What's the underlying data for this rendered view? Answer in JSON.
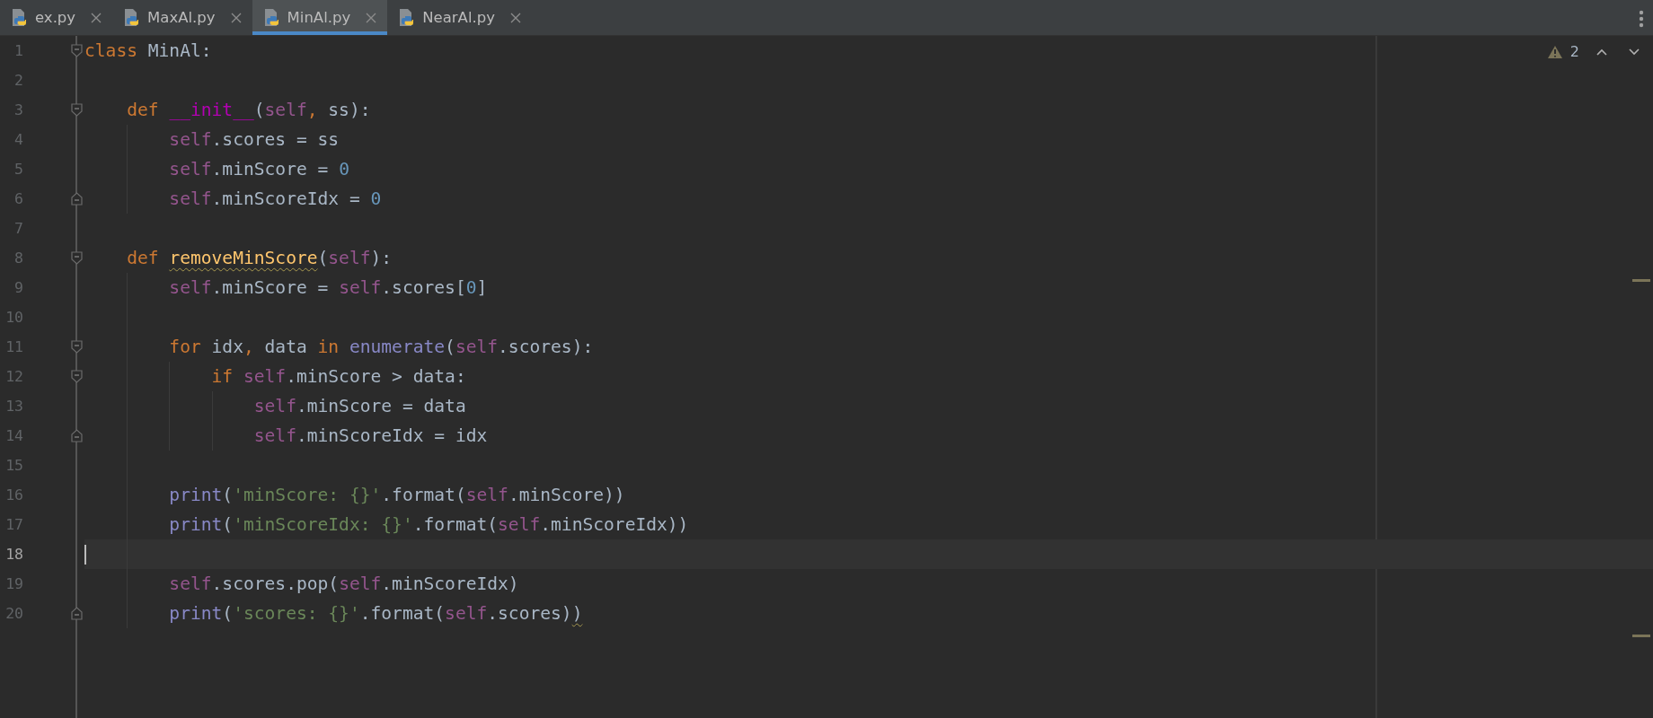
{
  "tabs": [
    {
      "label": "ex.py",
      "selected": false
    },
    {
      "label": "MaxAl.py",
      "selected": false
    },
    {
      "label": "MinAl.py",
      "selected": true
    },
    {
      "label": "NearAl.py",
      "selected": false
    }
  ],
  "inspections": {
    "warning_count": "2"
  },
  "lines": [
    {
      "number": "1",
      "current": false,
      "fold_start": true,
      "tokens": [
        {
          "text": "class",
          "kind": "keyword"
        },
        {
          "text": " MinAl:",
          "kind": "plain"
        }
      ]
    },
    {
      "number": "2",
      "current": false
    },
    {
      "number": "3",
      "current": false,
      "fold_start": true,
      "tokens": [
        {
          "text": "    def ",
          "kind": "keyword"
        },
        {
          "text": "__init__",
          "kind": "magic"
        },
        {
          "text": "(",
          "kind": "plain"
        },
        {
          "text": "self",
          "kind": "self"
        },
        {
          "text": ",",
          "kind": "keyword"
        },
        {
          "text": " ss):",
          "kind": "plain"
        }
      ]
    },
    {
      "number": "4",
      "current": false,
      "tokens": [
        {
          "text": "        self",
          "kind": "self"
        },
        {
          "text": ".scores = ss",
          "kind": "plain"
        }
      ]
    },
    {
      "number": "5",
      "current": false,
      "tokens": [
        {
          "text": "        self",
          "kind": "self"
        },
        {
          "text": ".minScore = ",
          "kind": "plain"
        },
        {
          "text": "0",
          "kind": "number"
        }
      ]
    },
    {
      "number": "6",
      "current": false,
      "fold_end": true,
      "tokens": [
        {
          "text": "        self",
          "kind": "self"
        },
        {
          "text": ".minScoreIdx = ",
          "kind": "plain"
        },
        {
          "text": "0",
          "kind": "number"
        }
      ]
    },
    {
      "number": "7",
      "current": false
    },
    {
      "number": "8",
      "current": false,
      "fold_start": true,
      "tokens": [
        {
          "text": "    def ",
          "kind": "keyword"
        },
        {
          "text": "removeMinScore",
          "kind": "function",
          "warning": true
        },
        {
          "text": "(",
          "kind": "plain"
        },
        {
          "text": "self",
          "kind": "self"
        },
        {
          "text": "):",
          "kind": "plain"
        }
      ]
    },
    {
      "number": "9",
      "current": false,
      "tokens": [
        {
          "text": "        self",
          "kind": "self"
        },
        {
          "text": ".minScore = ",
          "kind": "plain"
        },
        {
          "text": "self",
          "kind": "self"
        },
        {
          "text": ".scores[",
          "kind": "plain"
        },
        {
          "text": "0",
          "kind": "number"
        },
        {
          "text": "]",
          "kind": "plain"
        }
      ]
    },
    {
      "number": "10",
      "current": false
    },
    {
      "number": "11",
      "current": false,
      "fold_start": true,
      "tokens": [
        {
          "text": "        for",
          "kind": "keyword"
        },
        {
          "text": " idx",
          "kind": "plain"
        },
        {
          "text": ",",
          "kind": "keyword"
        },
        {
          "text": " data ",
          "kind": "plain"
        },
        {
          "text": "in ",
          "kind": "keyword"
        },
        {
          "text": "enumerate",
          "kind": "builtin"
        },
        {
          "text": "(",
          "kind": "plain"
        },
        {
          "text": "self",
          "kind": "self"
        },
        {
          "text": ".scores):",
          "kind": "plain"
        }
      ]
    },
    {
      "number": "12",
      "current": false,
      "fold_start": true,
      "tokens": [
        {
          "text": "            if ",
          "kind": "keyword"
        },
        {
          "text": "self",
          "kind": "self"
        },
        {
          "text": ".minScore > data:",
          "kind": "plain"
        }
      ]
    },
    {
      "number": "13",
      "current": false,
      "tokens": [
        {
          "text": "                self",
          "kind": "self"
        },
        {
          "text": ".minScore = data",
          "kind": "plain"
        }
      ]
    },
    {
      "number": "14",
      "current": false,
      "fold_end": true,
      "tokens": [
        {
          "text": "                self",
          "kind": "self"
        },
        {
          "text": ".minScoreIdx = idx",
          "kind": "plain"
        }
      ]
    },
    {
      "number": "15",
      "current": false
    },
    {
      "number": "16",
      "current": false,
      "tokens": [
        {
          "text": "        print",
          "kind": "builtin"
        },
        {
          "text": "(",
          "kind": "plain"
        },
        {
          "text": "'minScore: {}'",
          "kind": "string"
        },
        {
          "text": ".format(",
          "kind": "plain"
        },
        {
          "text": "self",
          "kind": "self"
        },
        {
          "text": ".minScore))",
          "kind": "plain"
        }
      ]
    },
    {
      "number": "17",
      "current": false,
      "tokens": [
        {
          "text": "        print",
          "kind": "builtin"
        },
        {
          "text": "(",
          "kind": "plain"
        },
        {
          "text": "'minScoreIdx: {}'",
          "kind": "string"
        },
        {
          "text": ".format(",
          "kind": "plain"
        },
        {
          "text": "self",
          "kind": "self"
        },
        {
          "text": ".minScoreIdx))",
          "kind": "plain"
        }
      ]
    },
    {
      "number": "18",
      "current": true
    },
    {
      "number": "19",
      "current": false,
      "tokens": [
        {
          "text": "        self",
          "kind": "self"
        },
        {
          "text": ".scores.pop(",
          "kind": "plain"
        },
        {
          "text": "self",
          "kind": "self"
        },
        {
          "text": ".minScoreIdx)",
          "kind": "plain"
        }
      ]
    },
    {
      "number": "20",
      "current": false,
      "fold_end": true,
      "tokens": [
        {
          "text": "        print",
          "kind": "builtin"
        },
        {
          "text": "(",
          "kind": "plain"
        },
        {
          "text": "'scores: {}'",
          "kind": "string"
        },
        {
          "text": ".format(",
          "kind": "plain"
        },
        {
          "text": "self",
          "kind": "self"
        },
        {
          "text": ".scores)",
          "kind": "plain"
        },
        {
          "text": ")",
          "kind": "plain",
          "warning": true
        }
      ]
    }
  ]
}
